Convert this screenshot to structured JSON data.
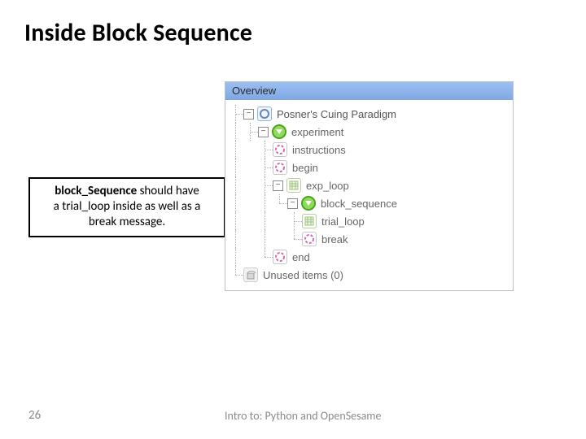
{
  "title": "Inside Block Sequence",
  "callout": {
    "strong": "block_Sequence",
    "rest_line1": " should have",
    "line2": "a trial_loop inside as well as a",
    "line3": "break message."
  },
  "panel": {
    "header": "Overview"
  },
  "tree": {
    "root": "Posner's Cuing Paradigm",
    "experiment": "experiment",
    "instructions": "instructions",
    "begin": "begin",
    "exp_loop": "exp_loop",
    "block_sequence": "block_sequence",
    "trial_loop": "trial_loop",
    "break": "break",
    "end": "end",
    "unused": "Unused items (0)"
  },
  "footer": {
    "page": "26",
    "text": "Intro to: Python and OpenSesame"
  }
}
